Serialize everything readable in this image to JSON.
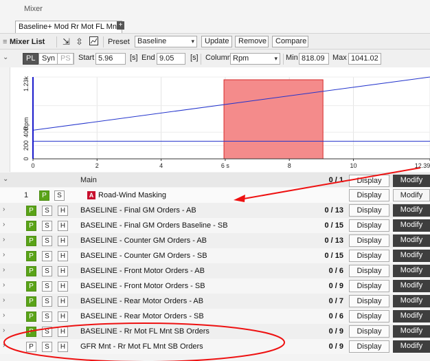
{
  "window": {
    "title": "Mixer"
  },
  "doc_tab": {
    "label": "Baseline+ Mod Rr Mot FL Mnt",
    "add": "+"
  },
  "toolbar": {
    "menu_glyph": "≡",
    "mixer_list": "Mixer List",
    "preset_label": "Preset",
    "preset_value": "Baseline",
    "update": "Update",
    "remove": "Remove",
    "compare": "Compare"
  },
  "controls": {
    "pl": "PL",
    "syn": "Syn",
    "ps": "PS",
    "start_label": "Start",
    "start_value": "5.96",
    "start_unit": "[s]",
    "end_label": "End",
    "end_value": "9.05",
    "end_unit": "[s]",
    "column_label": "Column",
    "column_value": "Rpm",
    "min_label": "Min",
    "min_value": "818.09",
    "max_label": "Max",
    "max_value": "1041.02"
  },
  "chart_data": {
    "type": "line",
    "ylabel": "Rpm",
    "y_tick_labels": [
      "0",
      "200",
      "400",
      "1.23k"
    ],
    "x_tick_labels": [
      "0",
      "2",
      "4",
      "6 s",
      "8",
      "10",
      "12.39"
    ],
    "xlim": [
      0,
      12.39
    ],
    "ylim": [
      0,
      1230
    ],
    "highlight_range": [
      5.96,
      9.05
    ],
    "series": [
      {
        "x": [
          0,
          12.39
        ],
        "y": [
          430,
          1230
        ]
      },
      {
        "x": [
          0,
          12.39
        ],
        "y": [
          265,
          265
        ]
      }
    ],
    "colors": {
      "line": "#2233cc",
      "highlight": "#f48b8b",
      "highlight_edge": "#d62828"
    }
  },
  "group": {
    "label": "Main",
    "count": "0 / 1"
  },
  "first_row": {
    "index": "1",
    "p": "P",
    "s": "S",
    "h": "H",
    "badge": "A",
    "name": "Road-Wind Masking",
    "display": "Display",
    "modify": "Modify"
  },
  "rows": [
    {
      "p": "P",
      "s": "S",
      "h": "H",
      "name": "BASELINE - Final GM Orders - AB",
      "count": "0 / 13",
      "display": "Display",
      "modify": "Modify"
    },
    {
      "p": "P",
      "s": "S",
      "h": "H",
      "name": "BASELINE - Final GM Orders Baseline - SB",
      "count": "0 / 15",
      "display": "Display",
      "modify": "Modify"
    },
    {
      "p": "P",
      "s": "S",
      "h": "H",
      "name": "BASELINE - Counter GM Orders - AB",
      "count": "0 / 13",
      "display": "Display",
      "modify": "Modify"
    },
    {
      "p": "P",
      "s": "S",
      "h": "H",
      "name": "BASELINE - Counter GM Orders - SB",
      "count": "0 / 15",
      "display": "Display",
      "modify": "Modify"
    },
    {
      "p": "P",
      "s": "S",
      "h": "H",
      "name": "BASELINE - Front Motor Orders - AB",
      "count": "0 / 6",
      "display": "Display",
      "modify": "Modify"
    },
    {
      "p": "P",
      "s": "S",
      "h": "H",
      "name": "BASELINE - Front Motor Orders - SB",
      "count": "0 / 9",
      "display": "Display",
      "modify": "Modify"
    },
    {
      "p": "P",
      "s": "S",
      "h": "H",
      "name": "BASELINE - Rear Motor Orders - AB",
      "count": "0 / 7",
      "display": "Display",
      "modify": "Modify"
    },
    {
      "p": "P",
      "s": "S",
      "h": "H",
      "name": "BASELINE - Rear Motor Orders - SB",
      "count": "0 / 6",
      "display": "Display",
      "modify": "Modify"
    },
    {
      "p": "P",
      "s": "S",
      "h": "H",
      "name": "BASELINE - Rr Mot FL Mnt SB Orders",
      "count": "0 / 9",
      "display": "Display",
      "modify": "Modify"
    },
    {
      "p": "P",
      "s": "S",
      "h": "H",
      "name": "GFR Mnt - Rr Mot FL Mnt SB Orders",
      "count": "0 / 9",
      "display": "Display",
      "modify": "Modify"
    }
  ]
}
